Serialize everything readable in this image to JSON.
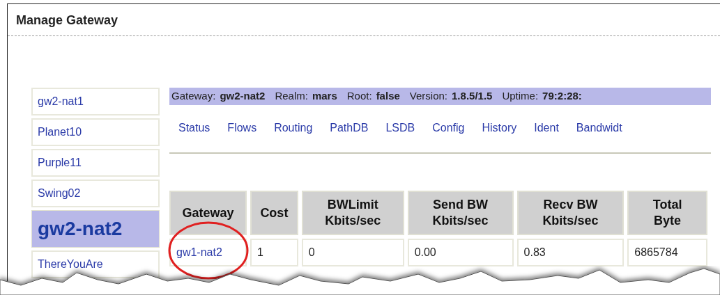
{
  "window": {
    "title": "Manage Gateway"
  },
  "sidebar": {
    "items": [
      {
        "label": "gw2-nat1",
        "selected": false
      },
      {
        "label": "Planet10",
        "selected": false
      },
      {
        "label": "Purple11",
        "selected": false
      },
      {
        "label": "Swing02",
        "selected": false
      },
      {
        "label": "gw2-nat2",
        "selected": true
      },
      {
        "label": "ThereYouAre",
        "selected": false
      }
    ]
  },
  "info_bar": [
    {
      "label": "Gateway:",
      "value": "gw2-nat2"
    },
    {
      "label": "Realm:",
      "value": "mars"
    },
    {
      "label": "Root:",
      "value": "false"
    },
    {
      "label": "Version:",
      "value": "1.8.5/1.5"
    },
    {
      "label": "Uptime:",
      "value": "79:2:28:"
    }
  ],
  "nav": [
    "Status",
    "Flows",
    "Routing",
    "PathDB",
    "LSDB",
    "Config",
    "History",
    "Ident",
    "Bandwidt"
  ],
  "table": {
    "columns": [
      "Gateway",
      "Cost",
      "BWLimit\nKbits/sec",
      "Send BW\nKbits/sec",
      "Recv BW\nKbits/sec",
      "Total\nByte"
    ],
    "rows": [
      [
        "gw1-nat2",
        "1",
        "0",
        "0.00",
        "0.83",
        "6865784"
      ]
    ]
  }
}
